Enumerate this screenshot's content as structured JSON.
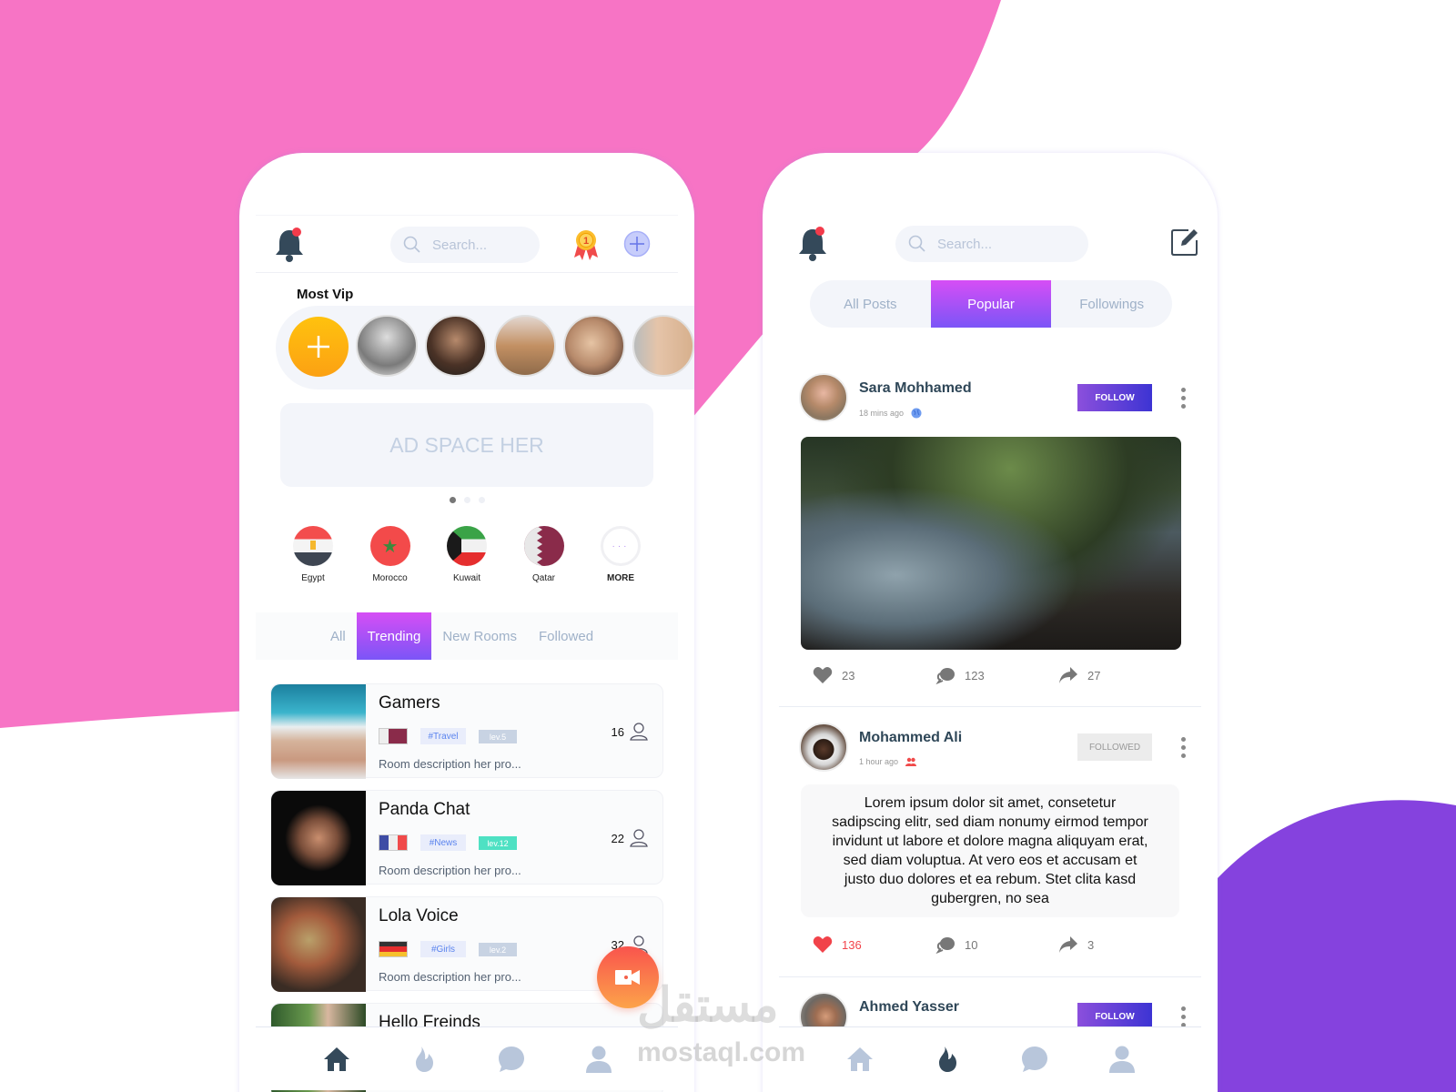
{
  "colors": {
    "pink_bg": "#f774c5",
    "purple_bg": "#8542de",
    "accent_gradient_start": "#d64ef5",
    "accent_gradient_end": "#7b55f7",
    "follow_start": "#8b4fdc",
    "follow_end": "#3d34d3",
    "like_red": "#f1434a"
  },
  "left_phone": {
    "header": {
      "notification_icon": "bell-icon",
      "search_placeholder": "Search...",
      "badge_icon": "medal-icon",
      "badge_number": "1",
      "add_icon": "plus-circle-icon"
    },
    "vip": {
      "title": "Most Vip",
      "add_icon": "plus-icon",
      "avatars": [
        "vip-1",
        "vip-2",
        "vip-3",
        "vip-4",
        "vip-5"
      ]
    },
    "ad": {
      "text": "AD SPACE HER",
      "pages": 3,
      "active_page": 1
    },
    "countries": [
      {
        "name": "Egypt"
      },
      {
        "name": "Morocco"
      },
      {
        "name": "Kuwait"
      },
      {
        "name": "Qatar"
      },
      {
        "name": "MORE"
      }
    ],
    "room_tabs": [
      {
        "label": "All",
        "active": false
      },
      {
        "label": "Trending",
        "active": true
      },
      {
        "label": "New Rooms",
        "active": false
      },
      {
        "label": "Followed",
        "active": false
      }
    ],
    "rooms": [
      {
        "name": "Gamers",
        "flag": "Qatar",
        "tag": "#Travel",
        "level": "lev.5",
        "count": "16",
        "description": "Room description her pro..."
      },
      {
        "name": "Panda Chat",
        "flag": "France",
        "tag": "#News",
        "level": "lev.12",
        "count": "22",
        "description": "Room description her pro..."
      },
      {
        "name": "Lola Voice",
        "flag": "Germany",
        "tag": "#Girls",
        "level": "lev.2",
        "count": "32",
        "description": "Room description her pro..."
      },
      {
        "name": "Hello Freinds"
      }
    ],
    "fab_icon": "video-camera-icon",
    "bottom_nav": [
      {
        "icon": "home-icon",
        "active": true
      },
      {
        "icon": "fire-icon",
        "active": false
      },
      {
        "icon": "chat-icon",
        "active": false
      },
      {
        "icon": "user-icon",
        "active": false
      }
    ]
  },
  "right_phone": {
    "header": {
      "notification_icon": "bell-icon",
      "search_placeholder": "Search...",
      "compose_icon": "edit-icon"
    },
    "tabs": [
      {
        "label": "All Posts",
        "active": false
      },
      {
        "label": "Popular",
        "active": true
      },
      {
        "label": "Followings",
        "active": false
      }
    ],
    "posts": [
      {
        "author": "Sara Mohhamed",
        "time": "18 mins ago",
        "visibility_icon": "globe-icon",
        "follow_label": "FOLLOW",
        "followed": false,
        "likes": "23",
        "comments": "123",
        "shares": "27",
        "liked": false
      },
      {
        "author": "Mohammed Ali",
        "time": "1 hour ago",
        "visibility_icon": "friends-icon",
        "follow_label": "FOLLOWED",
        "followed": true,
        "text": "Lorem ipsum dolor sit amet, consetetur sadipscing elitr, sed diam nonumy eirmod tempor invidunt ut labore et dolore magna aliquyam erat, sed diam voluptua. At vero eos et accusam et justo duo dolores et ea rebum. Stet clita kasd gubergren, no sea",
        "likes": "136",
        "comments": "10",
        "shares": "3",
        "liked": true
      },
      {
        "author": "Ahmed Yasser",
        "follow_label": "FOLLOW",
        "followed": false
      }
    ],
    "bottom_nav": [
      {
        "icon": "home-icon",
        "active": false
      },
      {
        "icon": "fire-icon",
        "active": true
      },
      {
        "icon": "chat-icon",
        "active": false
      },
      {
        "icon": "user-icon",
        "active": false
      }
    ]
  },
  "watermark": {
    "arabic": "مستقل",
    "latin": "mostaql.com"
  }
}
